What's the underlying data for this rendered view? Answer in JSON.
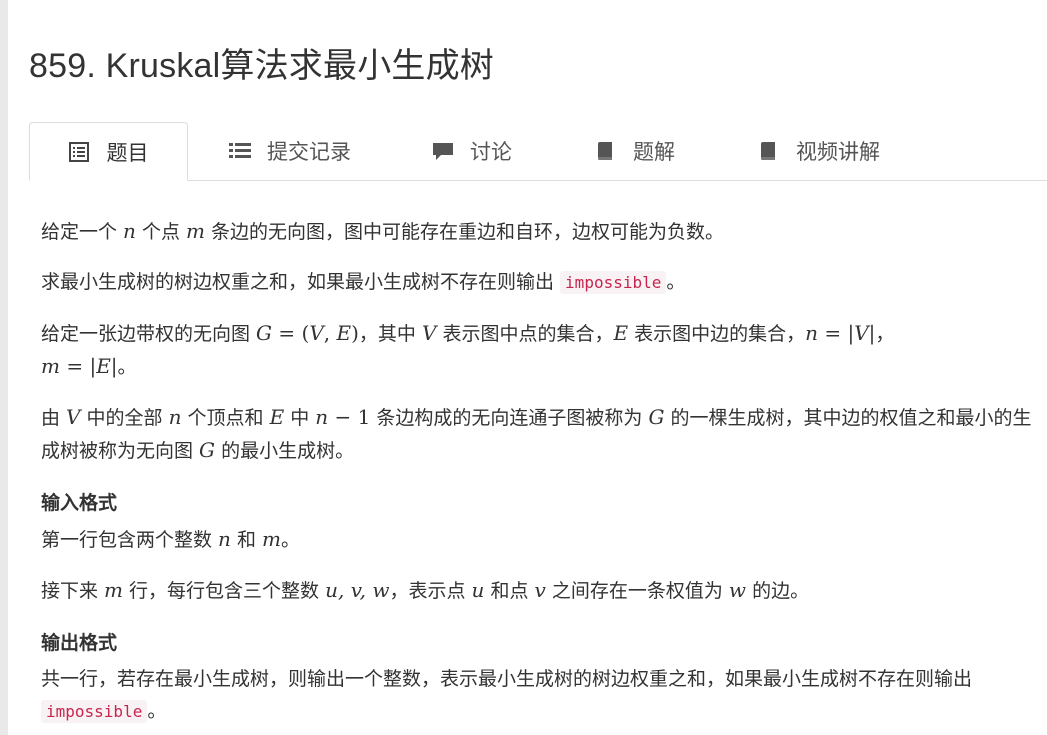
{
  "title": "859. Kruskal算法求最小生成树",
  "tabs": [
    {
      "label": "题目",
      "icon": "document-list-icon",
      "active": true
    },
    {
      "label": "提交记录",
      "icon": "list-icon",
      "active": false
    },
    {
      "label": "讨论",
      "icon": "comment-icon",
      "active": false
    },
    {
      "label": "题解",
      "icon": "book-icon",
      "active": false
    },
    {
      "label": "视频讲解",
      "icon": "book-icon",
      "active": false
    }
  ],
  "problem": {
    "p1": {
      "a": "给定一个 ",
      "n": "n",
      "b": " 个点 ",
      "m": "m",
      "c": " 条边的无向图，图中可能存在重边和自环，边权可能为负数。"
    },
    "p2": {
      "a": "求最小生成树的树边权重之和，如果最小生成树不存在则输出 ",
      "code": "impossible",
      "b": "。"
    },
    "p3": {
      "a": "给定一张边带权的无向图 ",
      "g": "G",
      "eq1": " = (",
      "v": "V",
      "comma": ", ",
      "e": "E",
      "close": ")",
      "b": "，其中 ",
      "v2": "V",
      "c": " 表示图中点的集合，",
      "e2": "E",
      "d": " 表示图中边的集合，",
      "n": "n",
      "eq2": " = |",
      "v3": "V",
      "bar": "|",
      "f": "，",
      "m": "m",
      "eq3": " = |",
      "e3": "E",
      "bar2": "|",
      "g2": "。"
    },
    "p4": {
      "a": "由 ",
      "v": "V",
      "b": " 中的全部 ",
      "n": "n",
      "c": " 个顶点和 ",
      "e": "E",
      "d": " 中 ",
      "n2": "n",
      "minus": " − 1",
      "f": " 条边构成的无向连通子图被称为 ",
      "g": "G",
      "h": " 的一棵生成树，其中边的权值之和最小的生成树被称为无向图 ",
      "g2": "G",
      "i": " 的最小生成树。"
    },
    "input_heading": "输入格式",
    "in1": {
      "a": "第一行包含两个整数 ",
      "n": "n",
      "b": " 和 ",
      "m": "m",
      "c": "。"
    },
    "in2": {
      "a": "接下来 ",
      "m": "m",
      "b": " 行，每行包含三个整数 ",
      "uvw": "u, v, w",
      "c": "，表示点 ",
      "u": "u",
      "d": " 和点 ",
      "v": "v",
      "e": " 之间存在一条权值为 ",
      "w": "w",
      "f": " 的边。"
    },
    "output_heading": "输出格式",
    "out1": {
      "a": "共一行，若存在最小生成树，则输出一个整数，表示最小生成树的树边权重之和，如果最小生成树不存在则输出",
      "code": "impossible",
      "b": "。"
    }
  }
}
